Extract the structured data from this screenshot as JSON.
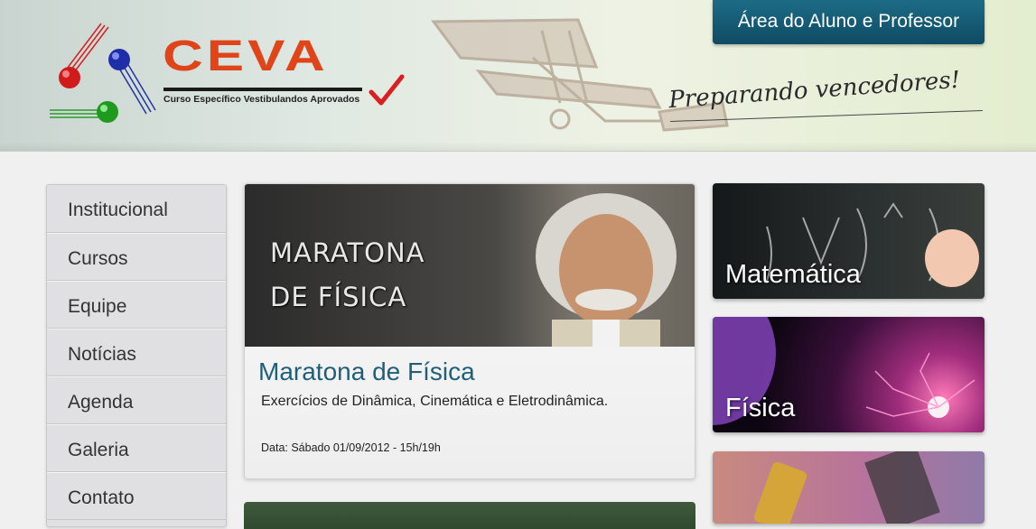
{
  "header": {
    "logo_text": "CEVA",
    "logo_subtitle": "Curso Específico Vestibulandos Aprovados",
    "slogan": "Preparando vencedores!",
    "portal_button": "Área do Aluno e Professor"
  },
  "sidebar": {
    "items": [
      {
        "label": "Institucional"
      },
      {
        "label": "Cursos"
      },
      {
        "label": "Equipe"
      },
      {
        "label": "Notícias"
      },
      {
        "label": "Agenda"
      },
      {
        "label": "Galeria"
      },
      {
        "label": "Contato"
      }
    ]
  },
  "feature": {
    "image_title_line1": "MARATONA",
    "image_title_line2": "DE FÍSICA",
    "title": "Maratona de Física",
    "description": "Exercícios de Dinâmica, Cinemática e Eletrodinâmica.",
    "date": "Data: Sábado 01/09/2012 - 15h/19h"
  },
  "tiles": [
    {
      "label": "Matemática"
    },
    {
      "label": "Física"
    },
    {
      "label": ""
    }
  ],
  "colors": {
    "logo": "#e0451a",
    "portal_button": "#155d78",
    "feature_title": "#1f5f7a"
  }
}
